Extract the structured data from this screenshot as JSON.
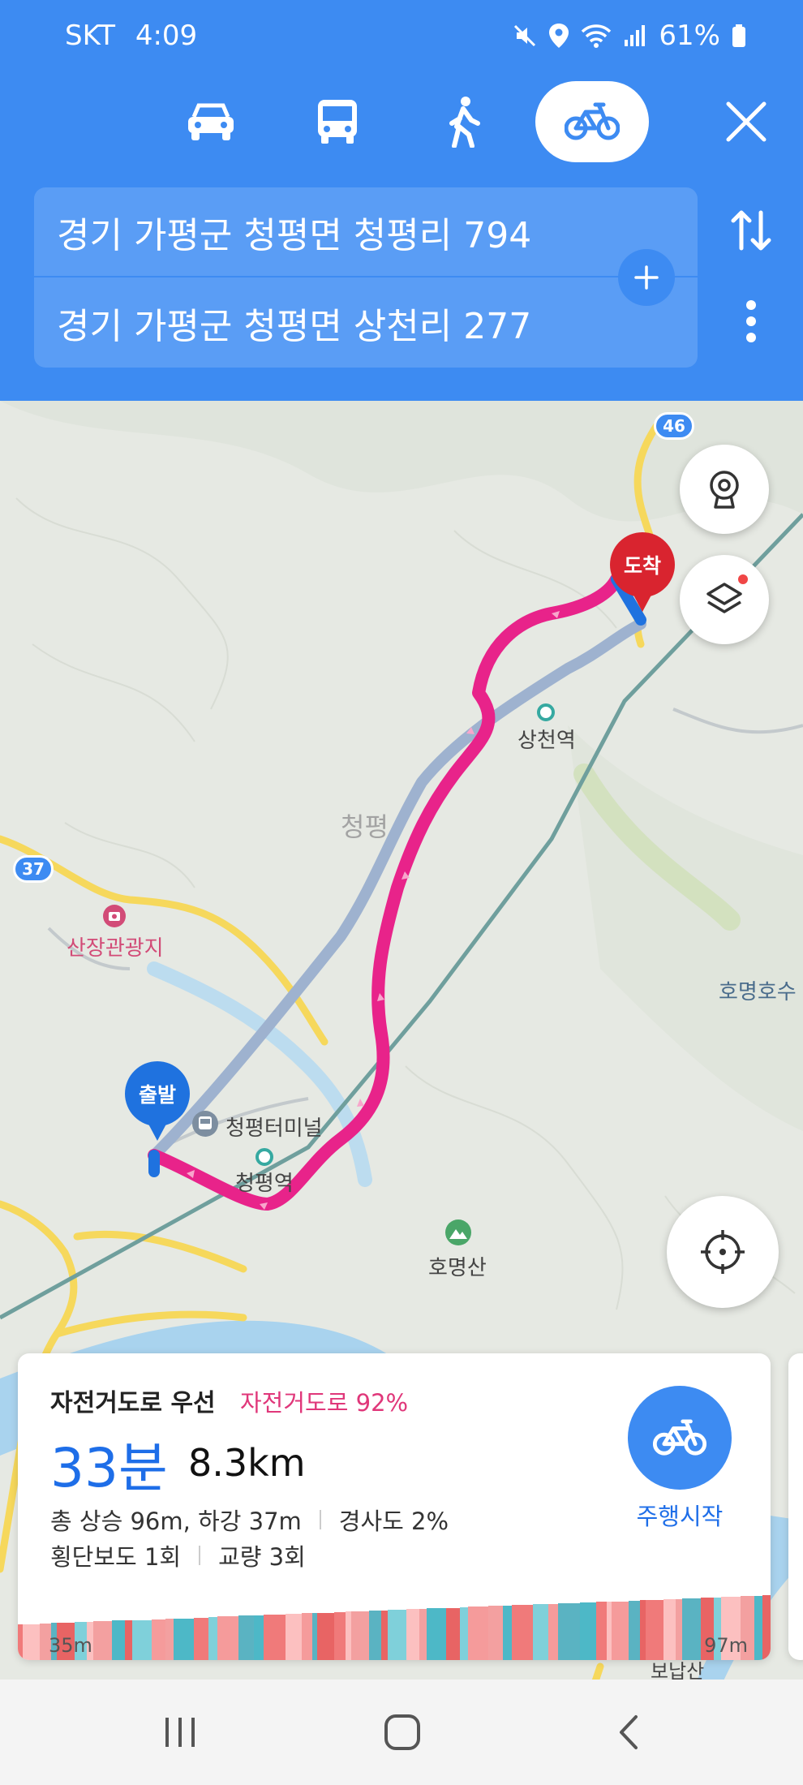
{
  "status_bar": {
    "carrier": "SKT",
    "time": "4:09",
    "battery": "61%",
    "icons": [
      "mute-icon",
      "location-icon",
      "wifi-icon",
      "signal-icon",
      "battery-icon"
    ]
  },
  "transport_modes": [
    {
      "name": "car",
      "icon": "car-icon",
      "selected": false
    },
    {
      "name": "bus",
      "icon": "bus-icon",
      "selected": false
    },
    {
      "name": "walk",
      "icon": "walk-icon",
      "selected": false
    },
    {
      "name": "bike",
      "icon": "bicycle-icon",
      "selected": true
    }
  ],
  "route_inputs": {
    "origin": "경기 가평군 청평면 청평리 794",
    "destination": "경기 가평군 청평면 상천리 277"
  },
  "map": {
    "start_pin": "출발",
    "end_pin": "도착",
    "labels": {
      "sangcheon_station": "상천역",
      "cheongpyeong_station": "청평역",
      "cheongpyeong_terminal": "청평터미널",
      "sanjang_resort": "산장관광지",
      "homyeong_lake": "호명호수",
      "homyeong_mountain": "호명산",
      "cheongpyeong_area": "청평",
      "bonapsan": "보납산"
    },
    "road_badges": {
      "route_46": "46",
      "route_37": "37"
    },
    "colors": {
      "route_bike": "#e8238a",
      "route_alt": "#9eb2cf",
      "start_pin": "#1f72df",
      "end_pin": "#d9242f"
    }
  },
  "route_card": {
    "route_type": "자전거도로 우선",
    "bike_road_ratio": "자전거도로 92%",
    "duration": "33분",
    "distance": "8.3km",
    "elevation_summary": "총 상승 96m, 하강 37m",
    "slope": "경사도 2%",
    "crosswalks": "횡단보도 1회",
    "bridges": "교량 3회",
    "start_button": "주행시작",
    "elevation_min": "35m",
    "elevation_max": "97m"
  },
  "nav_bar": {
    "buttons": [
      "recent-apps-icon",
      "home-icon",
      "back-icon"
    ]
  }
}
